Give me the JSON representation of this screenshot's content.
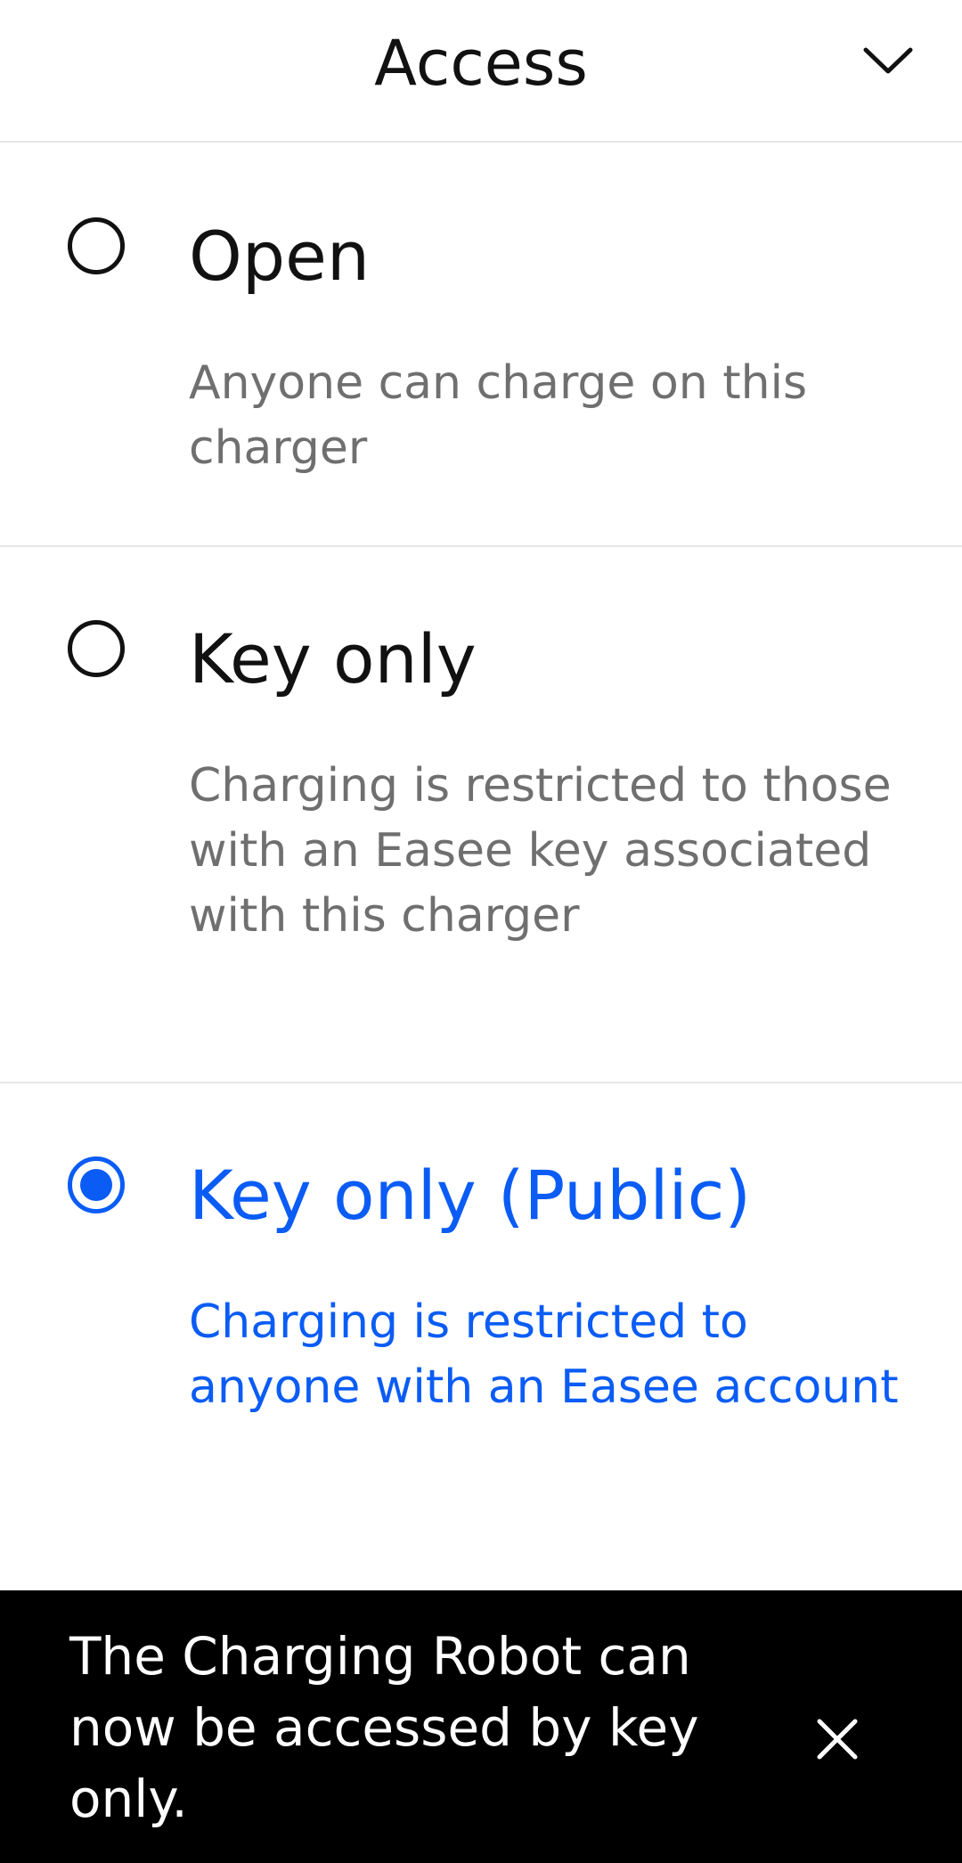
{
  "header": {
    "title": "Access",
    "collapse_icon": "chevron-down-icon"
  },
  "options": [
    {
      "title": "Open",
      "description": "Anyone can charge on this charger",
      "selected": false
    },
    {
      "title": "Key only",
      "description": "Charging is restricted to those with an Easee key associated with this charger",
      "selected": false
    },
    {
      "title": "Key only (Public)",
      "description": "Charging is restricted to anyone with an Easee account",
      "selected": true
    }
  ],
  "snackbar": {
    "message": "The Charging Robot can now be accessed by key only.",
    "close_icon": "close-icon"
  },
  "colors": {
    "accent": "#0a5cf5",
    "text_primary": "#111111",
    "text_secondary": "#6f6f6f",
    "snackbar_bg": "#000000"
  }
}
